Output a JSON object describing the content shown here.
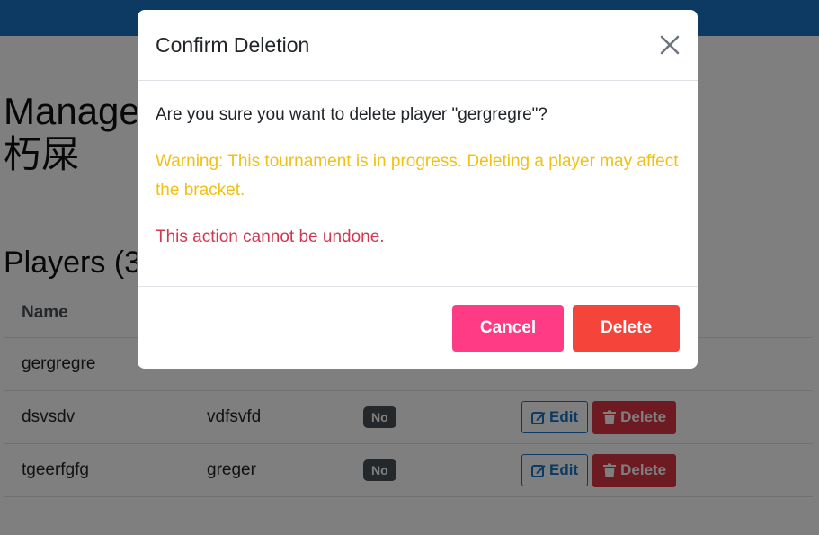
{
  "page": {
    "title_line1": "Manage",
    "title_line2": "朽屎",
    "section_title": "Players (3"
  },
  "table": {
    "headers": [
      "Name",
      "",
      "",
      ""
    ],
    "rows": [
      {
        "name": "gergregre",
        "team": "",
        "badge": "",
        "edit": "",
        "delete": ""
      },
      {
        "name": "dsvsdv",
        "team": "vdfsvfd",
        "badge": "No",
        "edit": "Edit",
        "delete": "Delete"
      },
      {
        "name": "tgeerfgfg",
        "team": "greger",
        "badge": "No",
        "edit": "Edit",
        "delete": "Delete"
      }
    ]
  },
  "modal": {
    "title": "Confirm Deletion",
    "question": "Are you sure you want to delete player \"gergregre\"?",
    "warning": "Warning: This tournament is in progress. Deleting a player may affect the bracket.",
    "danger": "This action cannot be undone.",
    "cancel_label": "Cancel",
    "delete_label": "Delete"
  },
  "colors": {
    "topbar": "#1b74c5",
    "warning_text": "#f1c012",
    "danger_text": "#d1374e",
    "cancel_button": "#ff3b85",
    "delete_button": "#f5443a"
  },
  "icons": {
    "close": "close-icon",
    "edit": "edit-icon",
    "trash": "trash-icon"
  }
}
